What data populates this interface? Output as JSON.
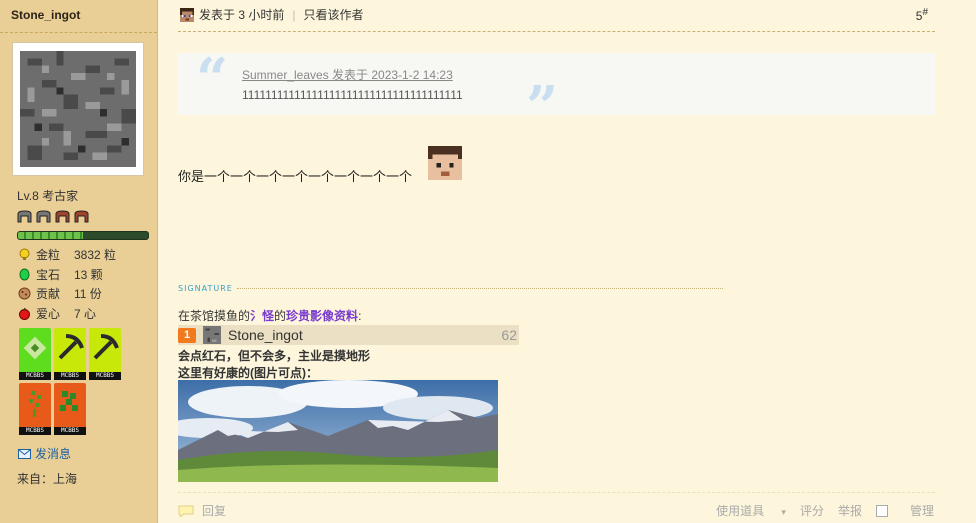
{
  "user": {
    "name": "Stone_ingot",
    "level": "Lv.8 考古家",
    "stats": [
      {
        "icon": "gold-nugget-icon",
        "label": "金粒",
        "value": "3832 粒"
      },
      {
        "icon": "emerald-icon",
        "label": "宝石",
        "value": "13 颗"
      },
      {
        "icon": "cookie-icon",
        "label": "贡献",
        "value": "11 份"
      },
      {
        "icon": "apple-icon",
        "label": "爱心",
        "value": "7 心"
      }
    ],
    "medal_tag": "MCBBS",
    "send_message": "发消息",
    "from": "来自：上海",
    "xp_fraction": 0.5
  },
  "post": {
    "posted": "发表于 3 小时前",
    "only_author": "只看该作者",
    "floor": "5",
    "floor_sup": "#",
    "quote_by": "Summer_leaves 发表于 2023-1-2 14:23",
    "quote_text": "11111111111111111111111111111111111111",
    "body": "你是一个一个一个一个一个一个一个一个",
    "signature_label": "SIGNATURE",
    "sig_prefix": "在茶馆摸鱼的",
    "sig_name": "氵怪",
    "sig_of": "的",
    "sig_link": "珍贵影像资料",
    "sig_colon": ":",
    "rank_num": "1",
    "rank_name": "Stone_ingot",
    "rank_score": "62",
    "sig_line2": "会点红石，但不会多，主业是摸地形",
    "sig_line3": "这里有好康的(图片可点)："
  },
  "footer": {
    "reply": "回复",
    "use_tool": "使用道具",
    "rate": "评分",
    "report": "举报",
    "manage": "管理"
  },
  "colors": {
    "accent": "#1a5fa0",
    "sidebar": "#e9cf96",
    "bg": "#fdf6dc"
  }
}
